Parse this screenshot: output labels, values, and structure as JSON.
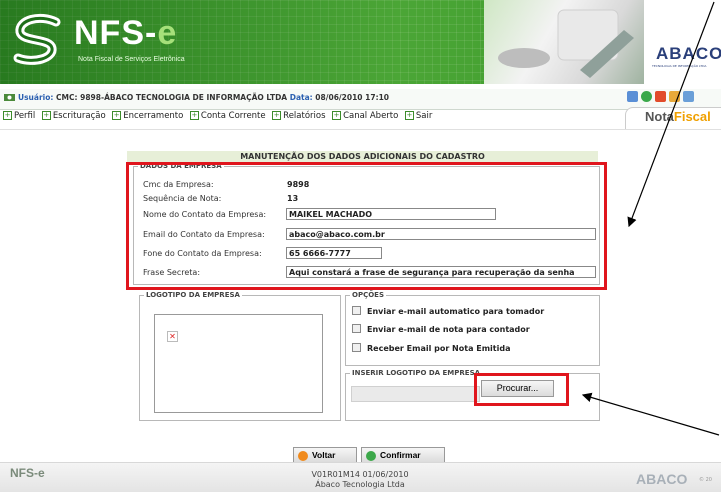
{
  "header": {
    "logo_title": "NFS-",
    "logo_title_e": "e",
    "logo_subtitle": "Nota Fiscal de Serviços Eletrônica",
    "brand": "ABACO",
    "brand_sub": "TECNOLOGIA DE INFORMAÇÃO LTDA"
  },
  "userbar": {
    "user_label": "Usuário:",
    "user_value": "CMC: 9898-ÁBACO TECNOLOGIA DE INFORMAÇÃO LTDA",
    "date_label": "Data:",
    "date_value": "08/06/2010 17:10"
  },
  "menu": {
    "items": [
      "Perfil",
      "Escrituração",
      "Encerramento",
      "Conta Corrente",
      "Relatórios",
      "Canal Aberto",
      "Sair"
    ]
  },
  "nota_tab": {
    "part1": "Nota",
    "part2": "Fiscal"
  },
  "form": {
    "title": "MANUTENÇÃO DOS DADOS ADICIONAIS DO CADASTRO",
    "dados_legend": "DADOS DA EMPRESA",
    "cmc_label": "Cmc da Empresa:",
    "cmc_value": "9898",
    "seq_label": "Sequência de Nota:",
    "seq_value": "13",
    "contato_label": "Nome do Contato da Empresa:",
    "contato_value": "MAIKEL MACHADO",
    "email_label": "Email do Contato da Empresa:",
    "email_value": "abaco@abaco.com.br",
    "fone_label": "Fone do Contato da Empresa:",
    "fone_value": "65 6666-7777",
    "frase_label": "Frase Secreta:",
    "frase_value": "Aqui constará a frase de segurança para recuperação da senha",
    "logotipo_legend": "LOGOTIPO DA EMPRESA",
    "opcoes_legend": "OPÇÕES",
    "opt1": "Enviar e-mail automatico para tomador",
    "opt2": "Enviar e-mail de nota para contador",
    "opt3": "Receber Email por Nota Emitida",
    "inserir_legend": "INSERIR LOGOTIPO DA EMPRESA",
    "procurar_label": "Procurar..."
  },
  "actions": {
    "voltar": "Voltar",
    "confirmar": "Confirmar"
  },
  "footer": {
    "version": "V01R01M14 01/06/2010",
    "company": "Ábaco Tecnologia Ltda",
    "logo": "NFS-e",
    "brand": "ABACO",
    "copy": "© 20"
  },
  "colors": {
    "highlight_red": "#e0151d",
    "brand_green": "#3c9a2a",
    "arrow": "#000000"
  }
}
